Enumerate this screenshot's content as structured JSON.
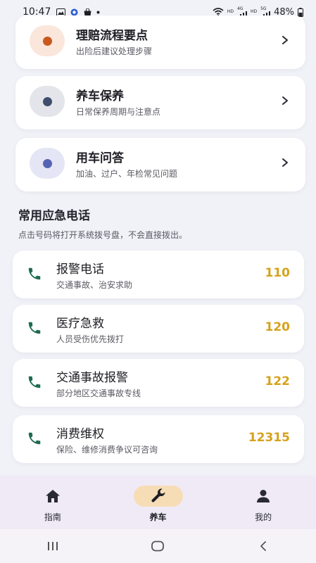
{
  "status_bar": {
    "time": "10:47",
    "battery": "48%",
    "net_labels": [
      "HD",
      "4G",
      "HD",
      "5G"
    ]
  },
  "guides": [
    {
      "title": "理赔流程要点",
      "subtitle": "出险后建议处理步骤",
      "dot_color": "#c8581e",
      "bg_color": "#fbe6db"
    },
    {
      "title": "养车保养",
      "subtitle": "日常保养周期与注意点",
      "dot_color": "#3f4f6b",
      "bg_color": "#e3e5ea"
    },
    {
      "title": "用车问答",
      "subtitle": "加油、过户、年检常见问题",
      "dot_color": "#5563b3",
      "bg_color": "#e4e6f5"
    }
  ],
  "emergency": {
    "title": "常用应急电话",
    "hint": "点击号码将打开系统拨号盘，不会直接拨出。",
    "items": [
      {
        "title": "报警电话",
        "subtitle": "交通事故、治安求助",
        "number": "110"
      },
      {
        "title": "医疗急救",
        "subtitle": "人员受伤优先拨打",
        "number": "120"
      },
      {
        "title": "交通事故报警",
        "subtitle": "部分地区交通事故专线",
        "number": "122"
      },
      {
        "title": "消费维权",
        "subtitle": "保险、维修消费争议可咨询",
        "number": "12315"
      }
    ]
  },
  "bottom_nav": {
    "items": [
      {
        "label": "指南",
        "icon": "home-icon",
        "active": false
      },
      {
        "label": "养车",
        "icon": "wrench-icon",
        "active": true
      },
      {
        "label": "我的",
        "icon": "person-icon",
        "active": false
      }
    ]
  },
  "colors": {
    "accent": "#d6a21d",
    "phone_icon": "#1f6b52",
    "active_nav": "#f6ddb6"
  }
}
